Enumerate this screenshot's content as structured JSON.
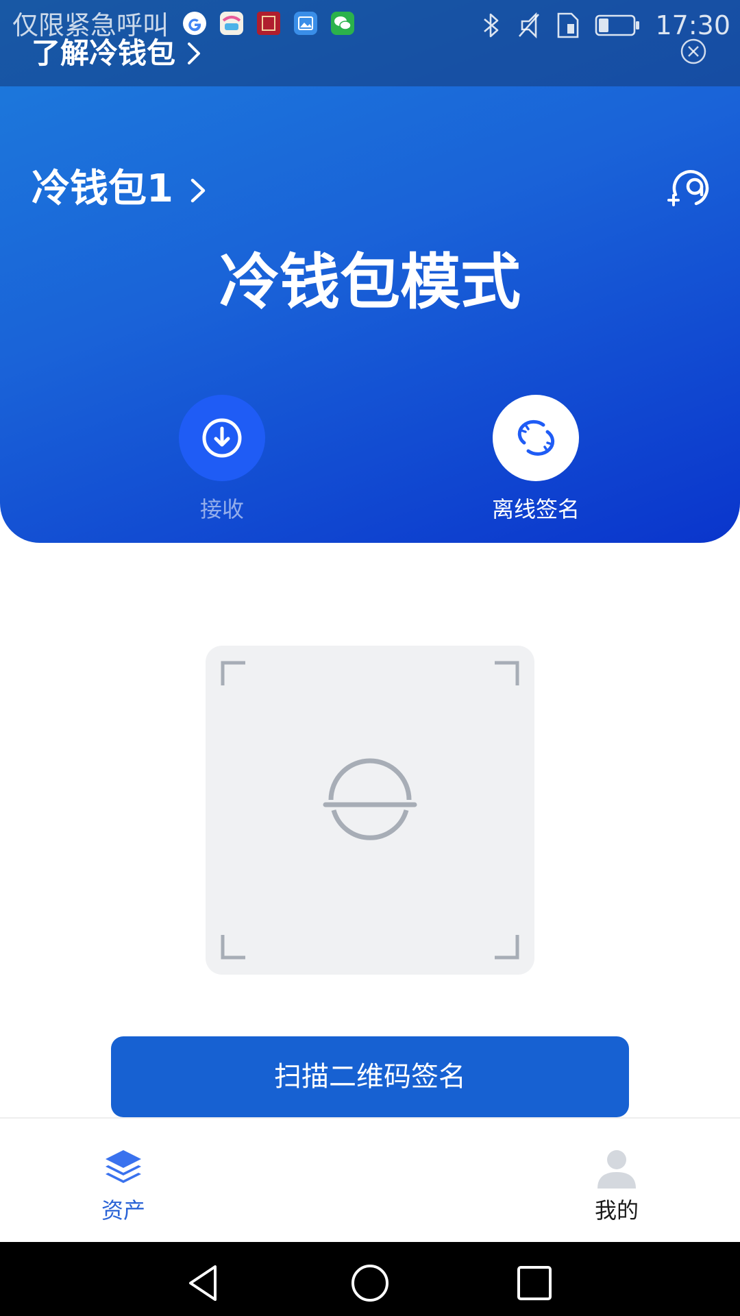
{
  "status_bar": {
    "carrier": "仅限紧急呼叫",
    "time": "17:30",
    "notification_icons": [
      "google-icon",
      "gallery-app-icon",
      "red-app-icon",
      "photos-icon",
      "wechat-icon"
    ]
  },
  "banner": {
    "text": "了解冷钱包"
  },
  "wallet": {
    "name": "冷钱包1",
    "mode_title": "冷钱包模式"
  },
  "actions": {
    "receive_label": "接收",
    "offline_sign_label": "离线签名"
  },
  "scan": {
    "button_label": "扫描二维码签名"
  },
  "tabs": [
    {
      "label": "资产",
      "icon": "layers-icon",
      "active": true
    },
    {
      "label": "我的",
      "icon": "person-icon",
      "active": false
    }
  ],
  "colors": {
    "primary": "#1761d2",
    "hero_start": "#1d7ddc",
    "hero_end": "#0a35cc",
    "scan_bg": "#f0f1f3",
    "tab_active": "#2a63d6"
  }
}
